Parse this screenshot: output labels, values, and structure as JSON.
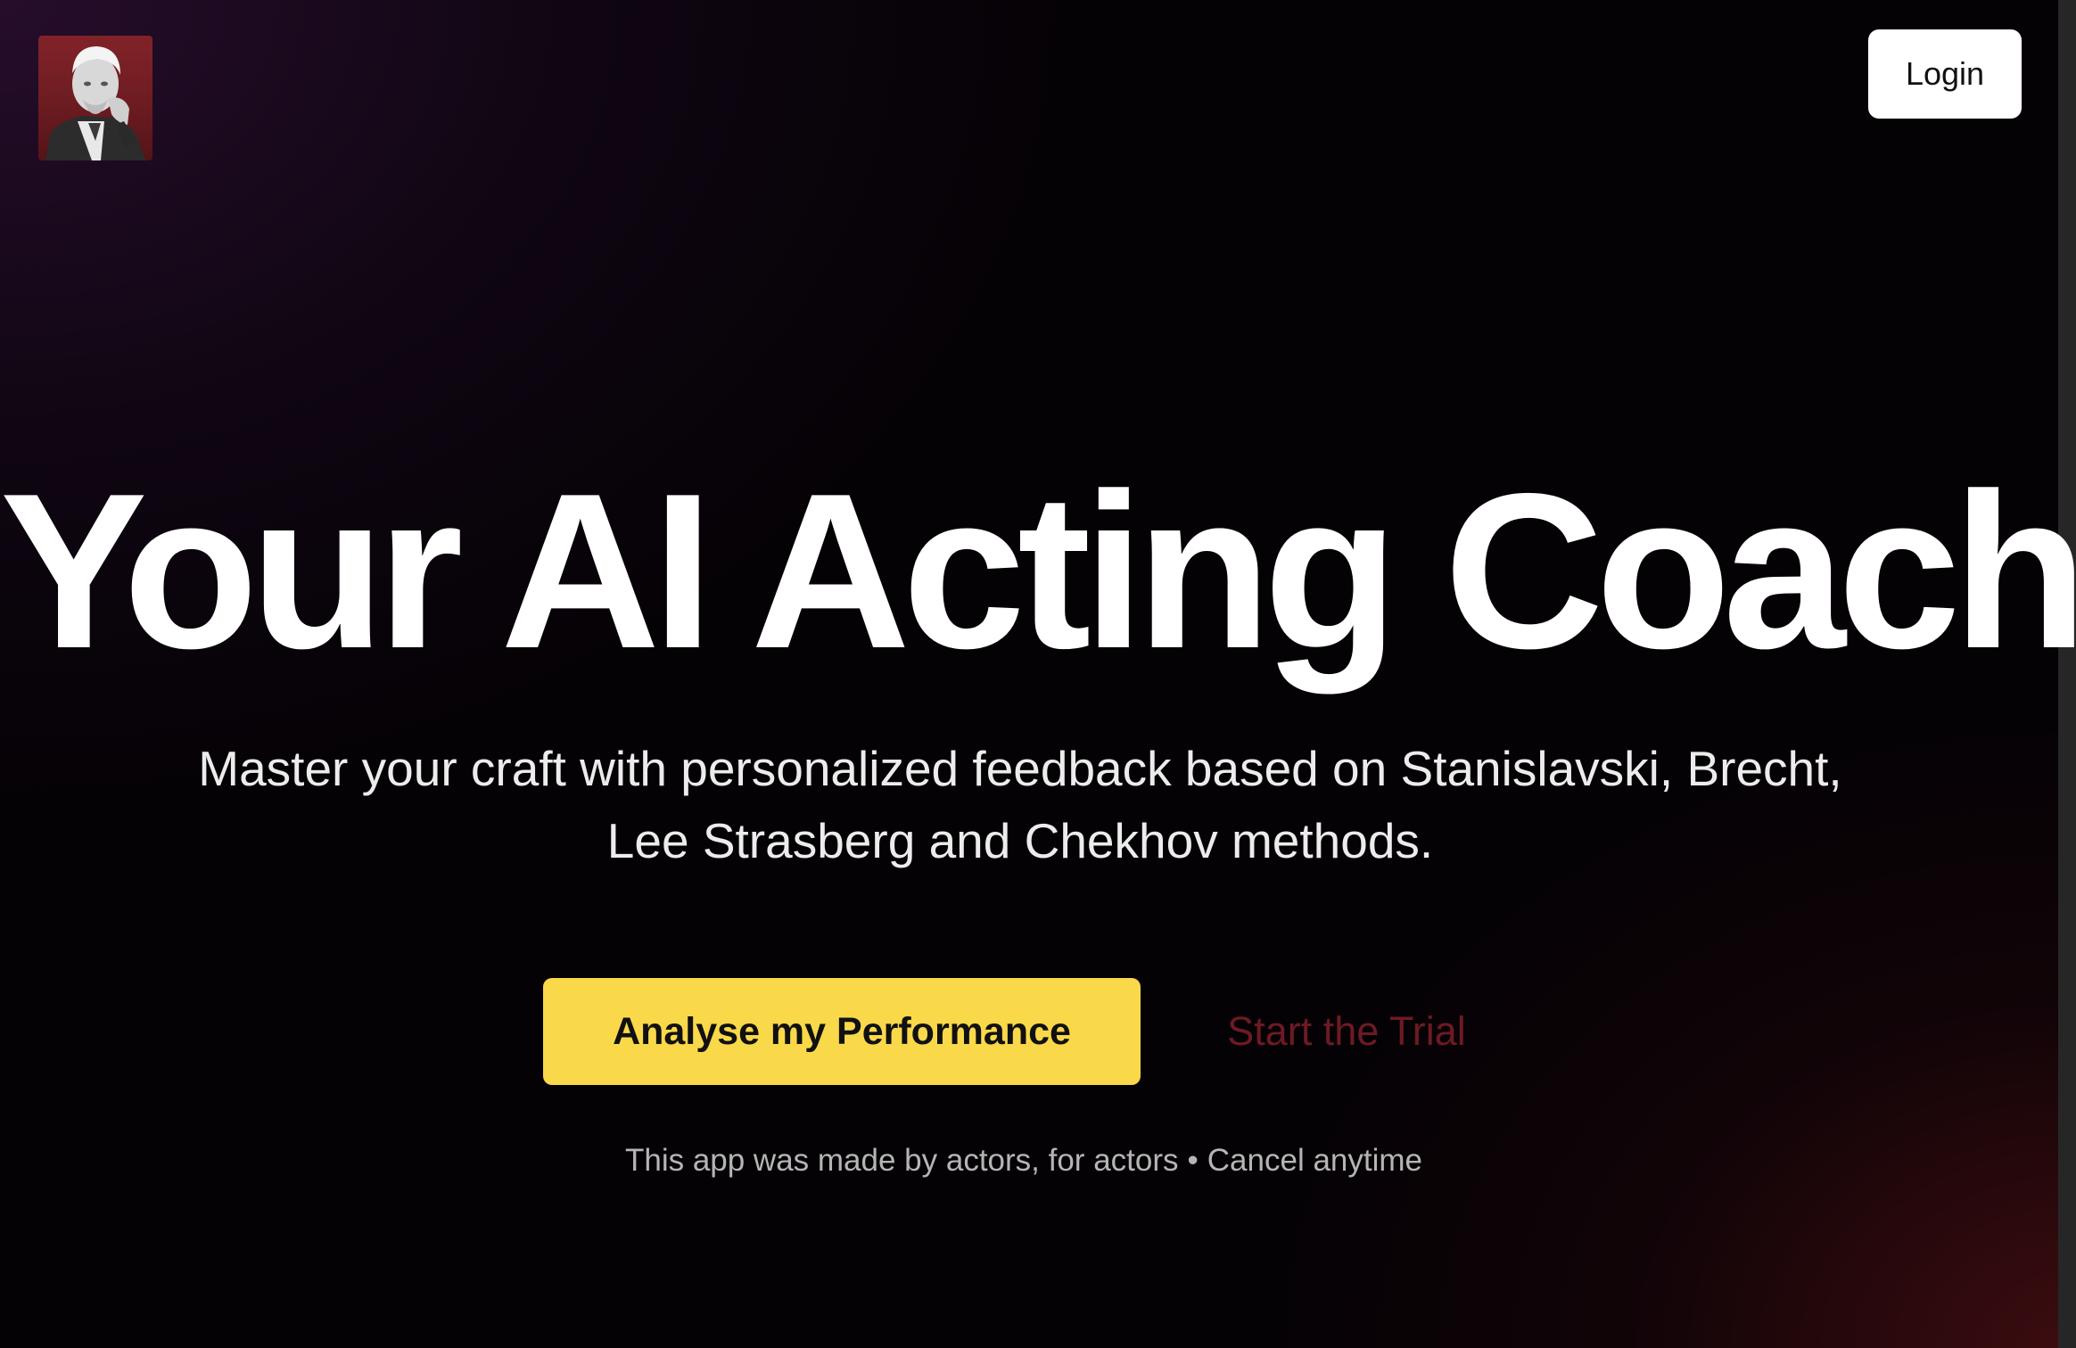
{
  "header": {
    "logo_icon": "portrait-logo-icon",
    "login_label": "Login"
  },
  "hero": {
    "title": "Your AI Acting Coach",
    "subtitle": "Master your craft with personalized feedback based on Stanislavski, Brecht, Lee Strasberg and Chekhov methods."
  },
  "actions": {
    "primary_label": "Analyse my Performance",
    "secondary_label": "Start the Trial"
  },
  "footnote": {
    "left_text": "This app was made by actors, for actors",
    "separator": "•",
    "right_text": "Cancel anytime"
  },
  "colors": {
    "primary_button": "#f9d84a",
    "secondary_link": "#6d1a24",
    "login_button": "#ffffff",
    "title_text": "#ffffff"
  }
}
